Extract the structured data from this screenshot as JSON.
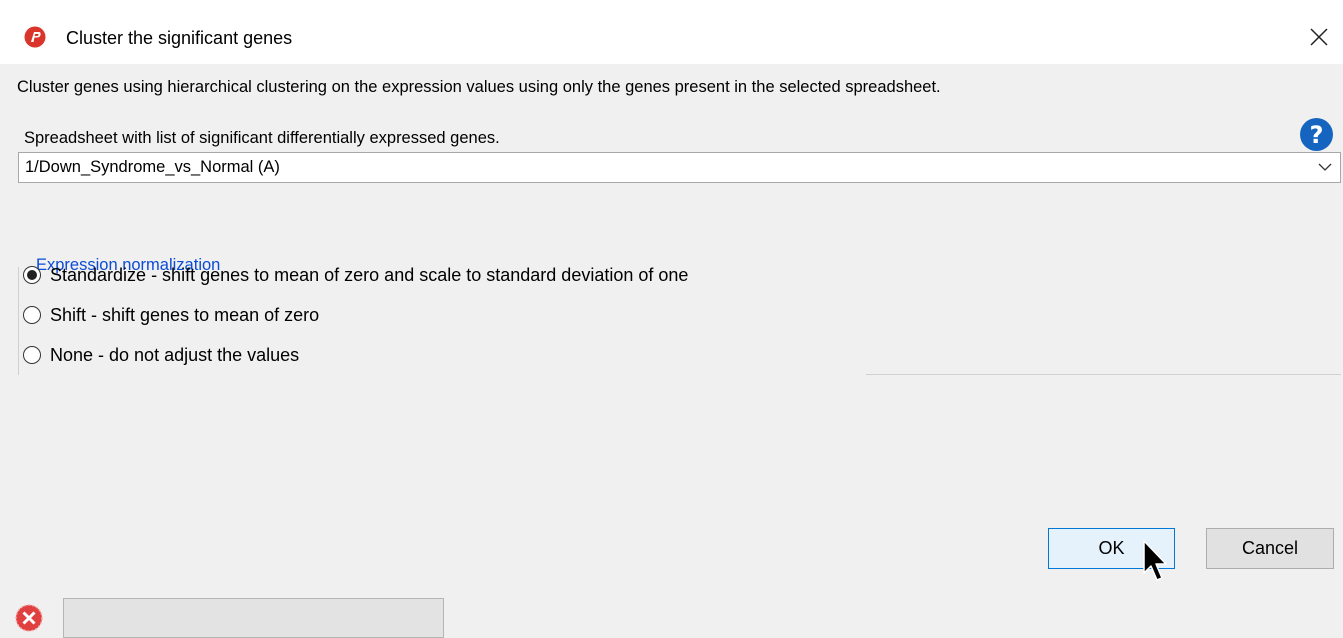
{
  "window": {
    "title": "Cluster the significant genes",
    "app_icon": "partek-logo-icon",
    "close_icon": "close-icon"
  },
  "description": "Cluster genes using hierarchical clustering on the expression values using only the genes present in the selected spreadsheet.",
  "spreadsheet": {
    "label": "Spreadsheet with list of significant differentially expressed genes.",
    "help_icon": "help-icon",
    "help_glyph": "?",
    "selected_value": "1/Down_Syndrome_vs_Normal (A)"
  },
  "normalization": {
    "group_title": "Expression normalization",
    "options": [
      {
        "label": "Standardize - shift genes to mean of zero and scale to standard deviation of one",
        "selected": true
      },
      {
        "label": "Shift - shift genes to mean of zero",
        "selected": false
      },
      {
        "label": "None - do not adjust the values",
        "selected": false
      }
    ]
  },
  "buttons": {
    "ok_label": "OK",
    "cancel_label": "Cancel"
  },
  "status": {
    "error_icon": "error-icon",
    "message": ""
  },
  "colors": {
    "group_title": "#0b4bd6",
    "help_icon_bg": "#1565c0",
    "ok_border": "#0078d7",
    "app_icon": "#d9352a",
    "error_icon": "#e04040"
  }
}
